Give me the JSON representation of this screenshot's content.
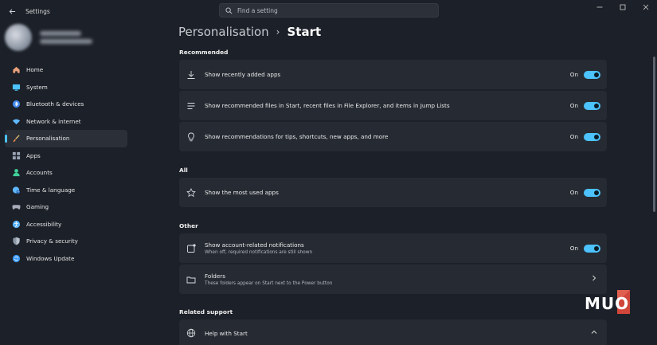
{
  "titlebar": {
    "app_title": "Settings",
    "search_placeholder": "Find a setting"
  },
  "sidebar": {
    "items": [
      {
        "label": "Home",
        "icon": "home-icon",
        "color": "#e8a07a"
      },
      {
        "label": "System",
        "icon": "system-icon",
        "color": "#4cc2ff"
      },
      {
        "label": "Bluetooth & devices",
        "icon": "bluetooth-icon",
        "color": "#4c9bff"
      },
      {
        "label": "Network & internet",
        "icon": "wifi-icon",
        "color": "#60b8ff"
      },
      {
        "label": "Personalisation",
        "icon": "brush-icon",
        "color": "#f0a050",
        "active": true
      },
      {
        "label": "Apps",
        "icon": "apps-icon",
        "color": "#9aa6b6"
      },
      {
        "label": "Accounts",
        "icon": "account-icon",
        "color": "#3fd19a"
      },
      {
        "label": "Time & language",
        "icon": "globe-clock-icon",
        "color": "#5fb8ff"
      },
      {
        "label": "Gaming",
        "icon": "gamepad-icon",
        "color": "#a6adb8"
      },
      {
        "label": "Accessibility",
        "icon": "accessibility-icon",
        "color": "#5ab2ff"
      },
      {
        "label": "Privacy & security",
        "icon": "shield-icon",
        "color": "#8c97a6"
      },
      {
        "label": "Windows Update",
        "icon": "update-icon",
        "color": "#3d9cff"
      }
    ]
  },
  "main": {
    "breadcrumb_parent": "Personalisation",
    "breadcrumb_current": "Start",
    "sections": {
      "recommended": "Recommended",
      "all": "All",
      "other": "Other",
      "related": "Related support"
    },
    "cards": {
      "recent_apps": {
        "title": "Show recently added apps",
        "state": "On"
      },
      "recommended_files": {
        "title": "Show recommended files in Start, recent files in File Explorer, and items in Jump Lists",
        "state": "On"
      },
      "recommendations_tips": {
        "title": "Show recommendations for tips, shortcuts, new apps, and more",
        "state": "On"
      },
      "most_used": {
        "title": "Show the most used apps",
        "state": "On"
      },
      "account_notifications": {
        "title": "Show account-related notifications",
        "subtitle": "When off, required notifications are still shown",
        "state": "On"
      },
      "folders": {
        "title": "Folders",
        "subtitle": "These folders appear on Start next to the Power button"
      },
      "help": {
        "title": "Help with Start"
      }
    }
  },
  "colors": {
    "accent": "#4cc2ff",
    "background": "#1c2028",
    "card": "#262b33"
  }
}
